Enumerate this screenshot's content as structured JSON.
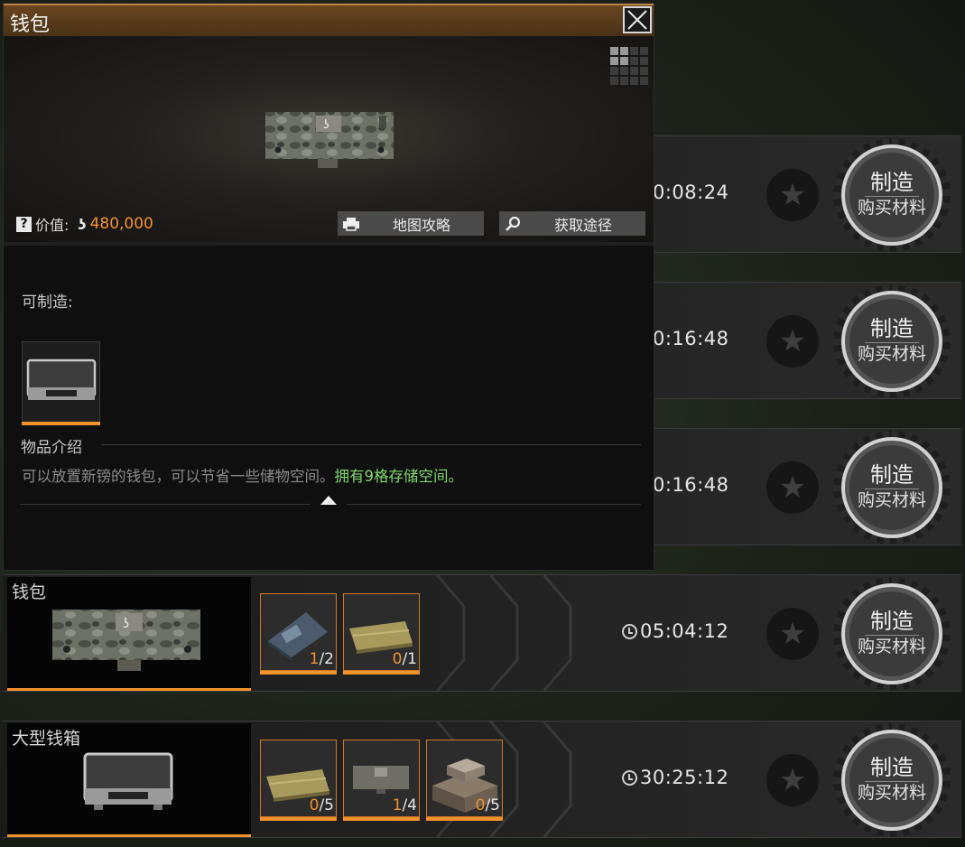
{
  "detail": {
    "title": "钱包",
    "value_label": "价值:",
    "value": "480,000",
    "map_guide_label": "地图攻略",
    "obtain_label": "获取途径",
    "craftable_label": "可制造:",
    "intro_label": "物品介绍",
    "intro_text": "可以放置新镑的钱包，可以节省一些储物空间。",
    "intro_highlight": "拥有9格存储空间。",
    "icons": [
      "help-icon",
      "coin-icon",
      "printer-icon",
      "search-icon",
      "grid-view-icon",
      "close-icon",
      "collapse-up-icon"
    ]
  },
  "craft_rows": [
    {
      "timer": "0:08:24",
      "craft_label": "制造",
      "buy_label": "购买材料"
    },
    {
      "timer": "0:16:48",
      "craft_label": "制造",
      "buy_label": "购买材料"
    },
    {
      "timer": "0:16:48",
      "craft_label": "制造",
      "buy_label": "购买材料"
    },
    {
      "name": "钱包",
      "timer": "05:04:12",
      "craft_label": "制造",
      "buy_label": "购买材料",
      "materials": [
        {
          "have": "1",
          "need": "/2"
        },
        {
          "have": "0",
          "need": "/1"
        }
      ]
    },
    {
      "name": "大型钱箱",
      "timer": "30:25:12",
      "craft_label": "制造",
      "buy_label": "购买材料",
      "materials": [
        {
          "have": "0",
          "need": "/5"
        },
        {
          "have": "1",
          "need": "/4"
        },
        {
          "have": "0",
          "need": "/5"
        }
      ]
    }
  ],
  "colors": {
    "accent": "#f2922a",
    "highlight": "#7fd86b",
    "header": "#5a3c1b"
  }
}
